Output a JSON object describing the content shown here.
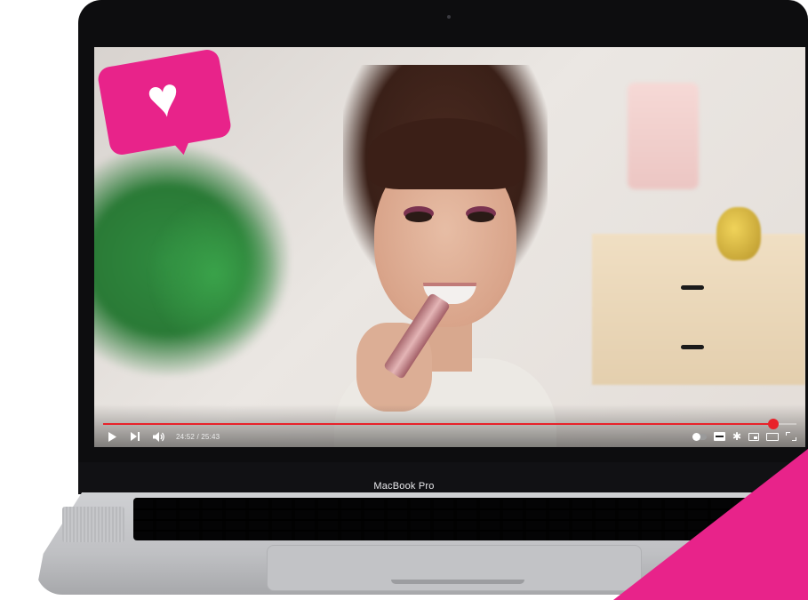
{
  "device": {
    "label": "MacBook Pro"
  },
  "player": {
    "current_time": "24:52",
    "duration": "25:43",
    "time_display": "24:52 / 25:43",
    "progress_fraction": 0.967,
    "controls_left": [
      "play-icon",
      "next-icon",
      "volume-icon"
    ],
    "controls_right": [
      "autoplay-toggle-icon",
      "subtitles-icon",
      "settings-gear-icon",
      "miniplayer-icon",
      "theater-mode-icon",
      "fullscreen-icon"
    ],
    "accent_color": "#e8222a"
  },
  "overlay": {
    "badge_icon": "heart-icon",
    "badge_color": "#e8238a",
    "corner_color": "#e8238a"
  }
}
